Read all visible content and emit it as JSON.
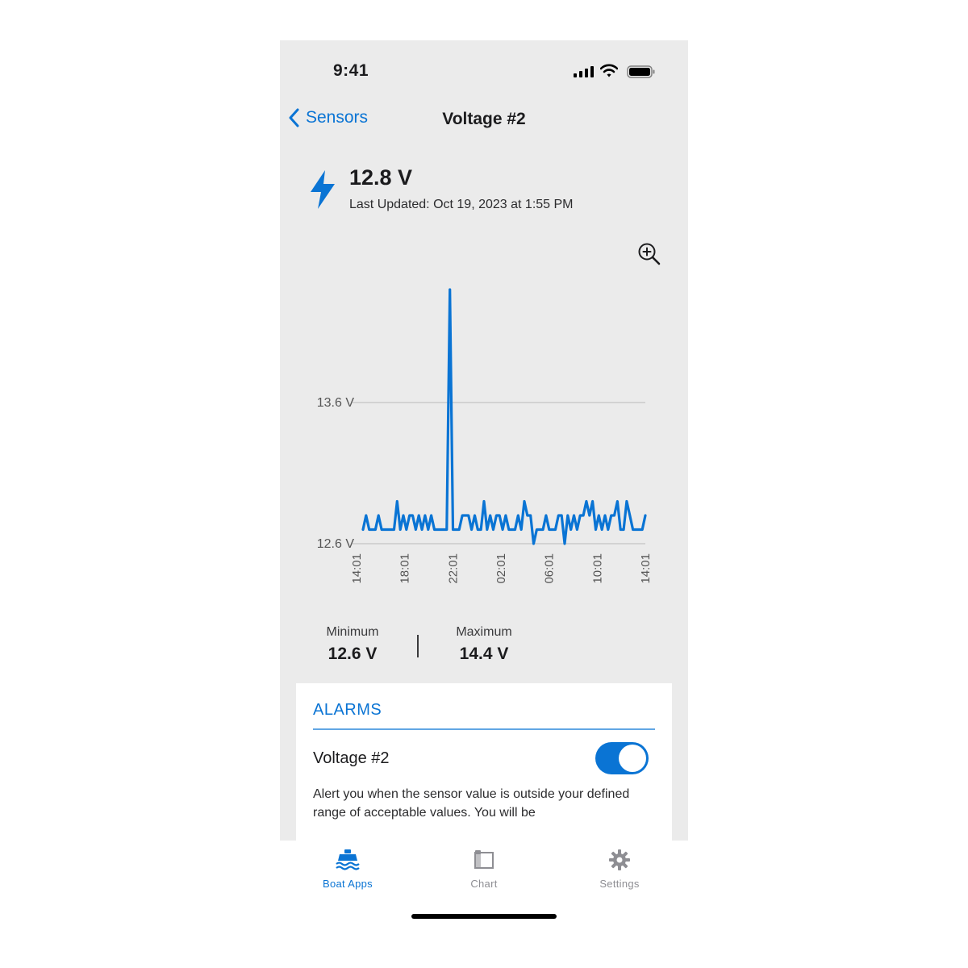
{
  "status_bar": {
    "time": "9:41"
  },
  "nav": {
    "back_label": "Sensors",
    "title": "Voltage #2"
  },
  "reading": {
    "value": "12.8 V",
    "updated": "Last Updated: Oct 19, 2023 at 1:55 PM"
  },
  "chart_data": {
    "type": "line",
    "y_ticks": [
      {
        "value": 12.6,
        "label": "12.6 V"
      },
      {
        "value": 13.6,
        "label": "13.6 V"
      }
    ],
    "x_tick_labels": [
      "14:01",
      "18:01",
      "22:01",
      "02:01",
      "06:01",
      "10:01",
      "14:01"
    ],
    "series": [
      {
        "color": "#0a74d4",
        "values": [
          12.7,
          12.8,
          12.7,
          12.7,
          12.7,
          12.8,
          12.7,
          12.7,
          12.7,
          12.7,
          12.7,
          12.9,
          12.7,
          12.8,
          12.7,
          12.8,
          12.8,
          12.7,
          12.8,
          12.7,
          12.8,
          12.7,
          12.8,
          12.7,
          12.7,
          12.7,
          12.7,
          12.7,
          14.4,
          12.7,
          12.7,
          12.7,
          12.8,
          12.8,
          12.8,
          12.7,
          12.8,
          12.7,
          12.7,
          12.9,
          12.7,
          12.8,
          12.7,
          12.8,
          12.8,
          12.7,
          12.8,
          12.7,
          12.7,
          12.7,
          12.8,
          12.7,
          12.9,
          12.8,
          12.8,
          12.6,
          12.7,
          12.7,
          12.7,
          12.8,
          12.7,
          12.7,
          12.7,
          12.8,
          12.8,
          12.6,
          12.8,
          12.7,
          12.8,
          12.7,
          12.8,
          12.8,
          12.9,
          12.8,
          12.9,
          12.7,
          12.8,
          12.7,
          12.8,
          12.7,
          12.8,
          12.8,
          12.9,
          12.7,
          12.7,
          12.9,
          12.8,
          12.7,
          12.7,
          12.7,
          12.7,
          12.8
        ],
        "x_range": [
          0,
          24
        ]
      }
    ],
    "ylim": [
      12.5,
      14.6
    ],
    "grid": true
  },
  "stats": {
    "min_label": "Minimum",
    "min_value": "12.6 V",
    "max_label": "Maximum",
    "max_value": "14.4 V"
  },
  "alarms": {
    "title": "ALARMS",
    "name": "Voltage #2",
    "enabled": true,
    "description": "Alert you when the sensor value is outside your defined range of acceptable values. You will be"
  },
  "tabs": [
    {
      "label": "Boat Apps",
      "icon": "boat-icon",
      "active": true,
      "color": "#0a74d4"
    },
    {
      "label": "Chart",
      "icon": "map-icon",
      "active": false,
      "color": "#8e8e93"
    },
    {
      "label": "Settings",
      "icon": "gear-icon",
      "active": false,
      "color": "#8e8e93"
    }
  ]
}
